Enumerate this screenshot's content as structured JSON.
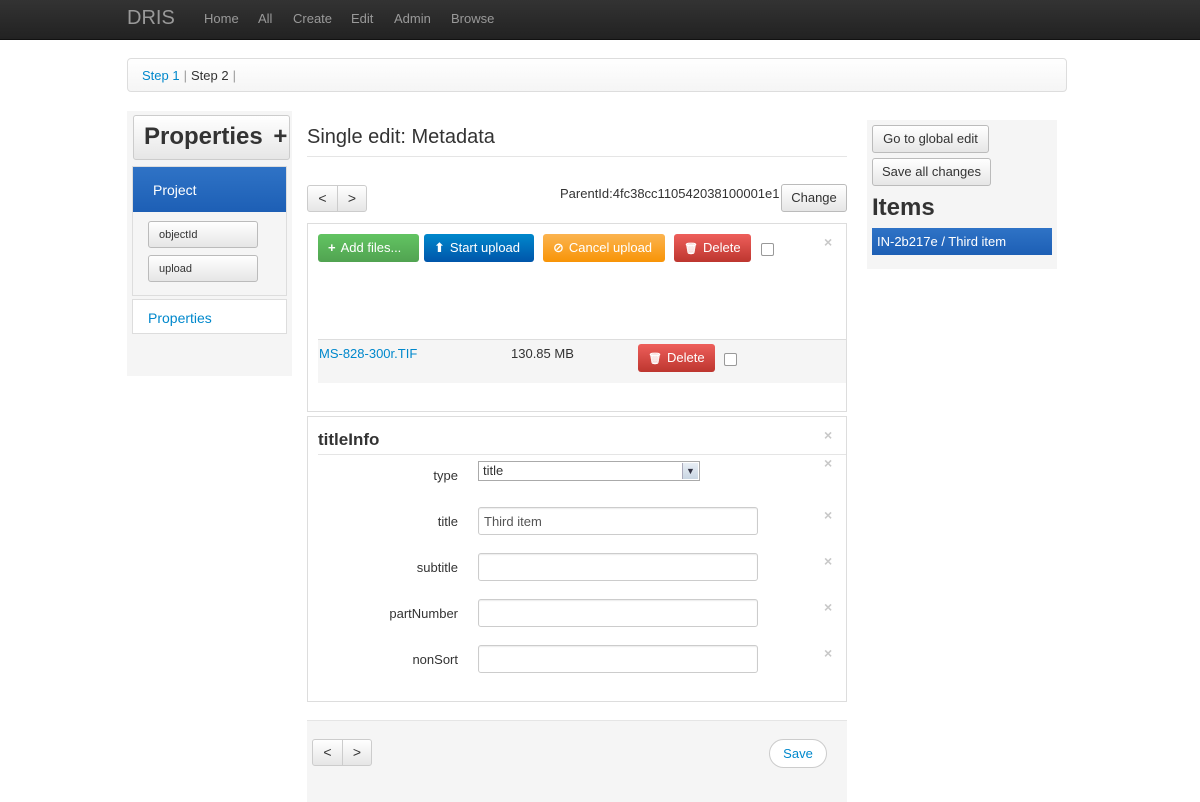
{
  "navbar": {
    "brand": "DRIS",
    "links": [
      "Home",
      "All",
      "Create",
      "Edit",
      "Admin",
      "Browse"
    ]
  },
  "breadcrumb": {
    "step1": "Step 1",
    "step2": "Step 2",
    "separator": "|"
  },
  "sidebar": {
    "title": "Properties",
    "add_icon": "+",
    "project_label": "Project",
    "buttons": [
      "objectId",
      "upload"
    ],
    "properties_link": "Properties"
  },
  "main": {
    "title": "Single edit: Metadata",
    "pager": {
      "prev": "<",
      "next": ">"
    },
    "parent_id": "ParentId:4fc38cc110542038100001e1",
    "change_label": "Change",
    "upload": {
      "add_files": "Add files...",
      "start_upload": "Start upload",
      "cancel_upload": "Cancel upload",
      "delete": "Delete",
      "colors": {
        "add": "#5bb75b",
        "start": "#0a6fd1",
        "cancel": "#f9a21c",
        "delete": "#d9453d"
      },
      "file": {
        "name": "MS-828-300r.TIF",
        "size": "130.85 MB",
        "delete": "Delete"
      }
    },
    "title_info": {
      "heading": "titleInfo",
      "type_label": "type",
      "type_value": "title",
      "fields": [
        {
          "label": "title",
          "value": "Third item"
        },
        {
          "label": "subtitle",
          "value": ""
        },
        {
          "label": "partNumber",
          "value": ""
        },
        {
          "label": "nonSort",
          "value": ""
        }
      ]
    },
    "footer": {
      "prev": "<",
      "next": ">",
      "save": "Save"
    }
  },
  "right_panel": {
    "global_edit": "Go to global edit",
    "save_all": "Save all changes",
    "items_title": "Items",
    "active_item": "IN-2b217e / Third item"
  },
  "icons": {
    "close": "×",
    "plus": "+",
    "upload": "⬆",
    "cancel": "⊘",
    "trash": "🗑"
  }
}
